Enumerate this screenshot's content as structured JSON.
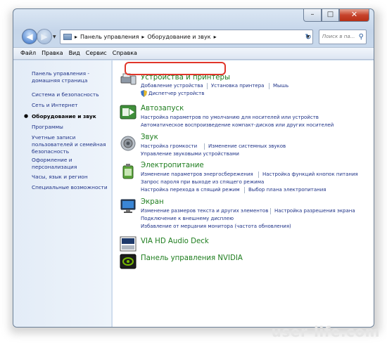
{
  "window": {
    "captions": {
      "minimize": "–",
      "maximize": "□",
      "close": "✕"
    }
  },
  "nav": {
    "address_parts": [
      "▸",
      "Панель управления",
      "▸",
      "Оборудование и звук",
      "▸"
    ],
    "search_placeholder": "Поиск в па...",
    "search_icon": "magnifier-icon"
  },
  "menu": [
    "Файл",
    "Правка",
    "Вид",
    "Сервис",
    "Справка"
  ],
  "sidebar": {
    "items": [
      {
        "label": "Панель управления - домашняя страница"
      },
      {
        "label": "Система и безопасность"
      },
      {
        "label": "Сеть и Интернет"
      },
      {
        "label": "Оборудование и звук",
        "active": true
      },
      {
        "label": "Программы"
      },
      {
        "label": "Учетные записи пользователей и семейная безопасность"
      },
      {
        "label": "Оформление и персонализация"
      },
      {
        "label": "Часы, язык и регион"
      },
      {
        "label": "Специальные возможности"
      }
    ]
  },
  "categories": {
    "devices": {
      "title": "Устройства и принтеры",
      "links": [
        "Добавление устройства",
        "Установка принтера",
        "Мышь",
        "Диспетчер устройств"
      ]
    },
    "autoplay": {
      "title": "Автозапуск",
      "links": [
        "Настройка параметров по умолчанию для носителей или устройств",
        "Автоматическое воспроизведение компакт-дисков или других носителей"
      ]
    },
    "sound": {
      "title": "Звук",
      "links": [
        "Настройка громкости",
        "Изменение системных звуков",
        "Управление звуковыми устройствами"
      ]
    },
    "power": {
      "title": "Электропитание",
      "links": [
        "Изменение параметров энергосбережения",
        "Настройка функций кнопок питания",
        "Запрос пароля при выходе из спящего режима",
        "Настройка перехода в спящий режим",
        "Выбор плана электропитания"
      ]
    },
    "display": {
      "title": "Экран",
      "links": [
        "Изменение размеров текста и других элементов",
        "Настройка разрешения экрана",
        "Подключение к внешнему дисплею",
        "Избавление от мерцания монитора (частота обновления)"
      ]
    },
    "via": {
      "title": "VIA HD Audio Deck"
    },
    "nvidia": {
      "title": "Панель управления NVIDIA"
    }
  },
  "watermark": "user-life.com",
  "colors": {
    "link": "#1e3287",
    "category_title": "#1e7d1e",
    "highlight": "#e0362a"
  }
}
